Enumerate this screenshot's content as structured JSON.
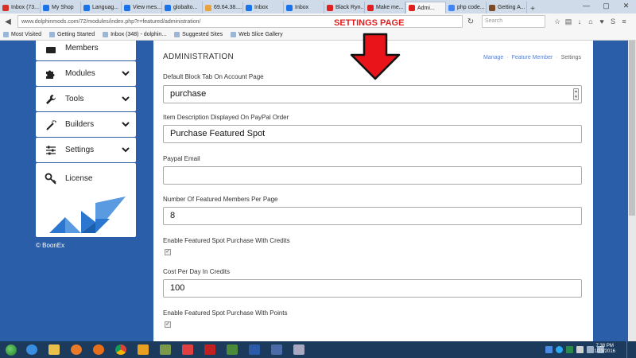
{
  "browser": {
    "tabs": [
      {
        "label": "Inbox (73...",
        "color": "#d93025"
      },
      {
        "label": "My Shop",
        "color": "#1a73e8"
      },
      {
        "label": "Languag...",
        "color": "#1a73e8"
      },
      {
        "label": "View mes...",
        "color": "#1a73e8"
      },
      {
        "label": "globalto...",
        "color": "#1a73e8"
      },
      {
        "label": "69.64.38....",
        "color": "#e8a33a"
      },
      {
        "label": "Inbox",
        "color": "#1a73e8"
      },
      {
        "label": "Inbox",
        "color": "#1a73e8"
      },
      {
        "label": "Black Ryn...",
        "color": "#e02020"
      },
      {
        "label": "Make me...",
        "color": "#e02020"
      },
      {
        "label": "Admi...",
        "color": "#e02020",
        "active": true
      },
      {
        "label": "php code...",
        "color": "#4285f4"
      },
      {
        "label": "Getting A...",
        "color": "#7a4a2a"
      }
    ],
    "url": "www.dolphinmods.com/72/modules/index.php?r=featured/administration/",
    "search_placeholder": "Search",
    "bookmarks": [
      "Most Visited",
      "Getting Started",
      "Inbox (348) - dolphin...",
      "Suggested Sites",
      "Web Slice Gallery"
    ]
  },
  "annotation": {
    "label": "SETTINGS PAGE"
  },
  "sidebar": {
    "items": [
      {
        "label": "Members",
        "icon": "members-icon"
      },
      {
        "label": "Modules",
        "icon": "puzzle-icon"
      },
      {
        "label": "Tools",
        "icon": "wrench-icon"
      },
      {
        "label": "Builders",
        "icon": "magic-wand-icon"
      },
      {
        "label": "Settings",
        "icon": "sliders-icon"
      }
    ],
    "license_label": "License",
    "copyright": "© BoonEx"
  },
  "panel": {
    "title": "ADMINISTRATION",
    "breadcrumb": {
      "manage": "Manage",
      "feature_member": "Feature Member",
      "settings": "Settings"
    }
  },
  "form": {
    "default_tab_label": "Default Block Tab On Account Page",
    "default_tab_value": "purchase",
    "item_desc_label": "Item Description Displayed On PayPal Order",
    "item_desc_value": "Purchase Featured Spot",
    "paypal_email_label": "Paypal Email",
    "paypal_email_value": "",
    "members_per_page_label": "Number Of Featured Members Per Page",
    "members_per_page_value": "8",
    "credits_enable_label": "Enable Featured Spot Purchase With Credits",
    "credits_enable_checked": true,
    "cost_credits_label": "Cost Per Day In Credits",
    "cost_credits_value": "100",
    "points_enable_label": "Enable Featured Spot Purchase With Points",
    "points_enable_checked": true
  },
  "taskbar": {
    "clock_time": "7:38 PM",
    "clock_date": "1/23/2016"
  },
  "colors": {
    "page_bg": "#2b5ea8",
    "annotation_red": "#e02020",
    "link": "#5a7fc9"
  }
}
